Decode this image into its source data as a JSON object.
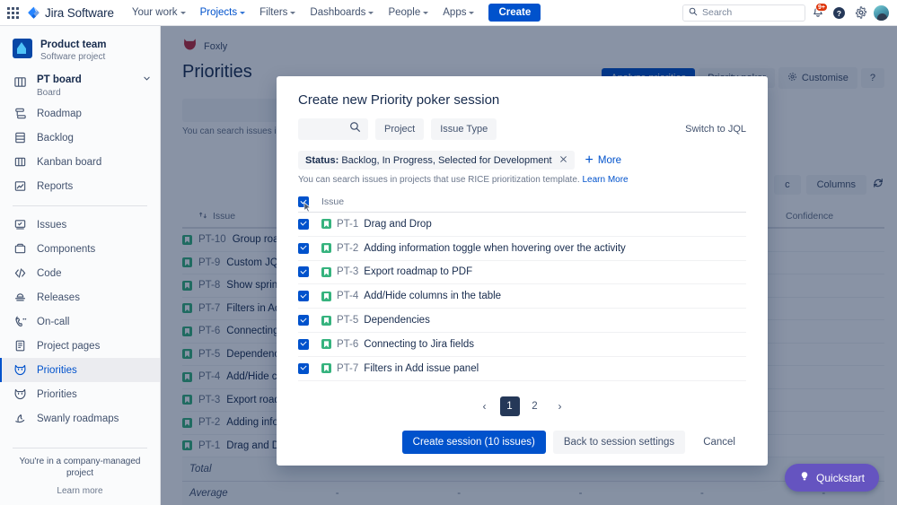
{
  "topnav": {
    "app_switcher_icon": "app-grid-icon",
    "brand": "Jira Software",
    "brand_logo_icon": "jira-logo-icon",
    "items": [
      {
        "label": "Your work",
        "active": false
      },
      {
        "label": "Projects",
        "active": true
      },
      {
        "label": "Filters",
        "active": false
      },
      {
        "label": "Dashboards",
        "active": false
      },
      {
        "label": "People",
        "active": false
      },
      {
        "label": "Apps",
        "active": false
      }
    ],
    "create_label": "Create",
    "search_placeholder": "Search",
    "search_icon": "search-icon",
    "notifications_icon": "bell-icon",
    "notifications_badge": "9+",
    "help_icon": "help-circle-icon",
    "settings_icon": "gear-icon",
    "avatar_icon": "avatar"
  },
  "sidebar": {
    "project_name": "Product team",
    "project_type": "Software project",
    "board": {
      "label": "PT board",
      "sub": "Board",
      "icon": "board-icon",
      "chevron": "chevron-down-icon"
    },
    "group1": [
      {
        "label": "Roadmap",
        "icon": "roadmap-icon"
      },
      {
        "label": "Backlog",
        "icon": "backlog-icon"
      },
      {
        "label": "Kanban board",
        "icon": "kanban-board-icon"
      },
      {
        "label": "Reports",
        "icon": "reports-icon"
      }
    ],
    "group2": [
      {
        "label": "Issues",
        "icon": "issues-icon",
        "selected": false
      },
      {
        "label": "Components",
        "icon": "components-icon",
        "selected": false
      },
      {
        "label": "Code",
        "icon": "code-icon",
        "selected": false
      },
      {
        "label": "Releases",
        "icon": "releases-icon",
        "selected": false
      },
      {
        "label": "On-call",
        "icon": "on-call-icon",
        "selected": false
      },
      {
        "label": "Project pages",
        "icon": "project-pages-icon",
        "selected": false
      },
      {
        "label": "Priorities",
        "icon": "foxly-icon",
        "selected": true
      },
      {
        "label": "Priorities",
        "icon": "foxly-icon",
        "selected": false
      },
      {
        "label": "Swanly roadmaps",
        "icon": "swanly-icon",
        "selected": false
      }
    ],
    "footer_note": "You're in a company-managed project",
    "footer_link": "Learn more"
  },
  "main": {
    "app_badge": "Foxly",
    "app_badge_icon": "foxly-logo-icon",
    "page_title": "Priorities",
    "actions": [
      {
        "label": "Analyze priorities",
        "style": "primary"
      },
      {
        "label": "Priority poker",
        "style": "subtle"
      },
      {
        "label": "Customise",
        "style": "subtle",
        "icon": "gear-icon"
      },
      {
        "label": "?",
        "style": "subtle"
      }
    ],
    "search_icon": "search-icon",
    "hint": "You can search issues in pr",
    "tools": [
      {
        "label": "c"
      },
      {
        "label": "Columns"
      }
    ],
    "refresh_icon": "refresh-icon",
    "table": {
      "columns": [
        "Issue",
        "Confidence"
      ],
      "sort_icon": "sort-icon",
      "rows": [
        {
          "key": "PT-10",
          "summary": "Group road"
        },
        {
          "key": "PT-9",
          "summary": "Custom JQL"
        },
        {
          "key": "PT-8",
          "summary": "Show sprints"
        },
        {
          "key": "PT-7",
          "summary": "Filters in Add"
        },
        {
          "key": "PT-6",
          "summary": "Connecting "
        },
        {
          "key": "PT-5",
          "summary": "Dependencie"
        },
        {
          "key": "PT-4",
          "summary": "Add/Hide co"
        },
        {
          "key": "PT-3",
          "summary": "Export roadm"
        },
        {
          "key": "PT-2",
          "summary": "Adding infor"
        },
        {
          "key": "PT-1",
          "summary": "Drag and Dro"
        }
      ],
      "total_label": "Total",
      "average_label": "Average",
      "empty_cell": "-"
    },
    "quickstart": {
      "label": "Quickstart",
      "icon": "lightbulb-icon"
    }
  },
  "modal": {
    "title": "Create new Priority poker session",
    "search_icon": "search-icon",
    "search_value": "",
    "filter_buttons": [
      "Project",
      "Issue Type"
    ],
    "switch_to_jql": "Switch to JQL",
    "chip": {
      "field": "Status:",
      "values": "Backlog, In Progress, Selected for Development",
      "remove_icon": "close-icon"
    },
    "more_label": "More",
    "more_icon": "plus-icon",
    "hint_text": "You can search issues in projects that use RICE prioritization template.",
    "hint_link": "Learn More",
    "list_header": "Issue",
    "header_checkbox_checked": true,
    "cursor_icon": "mouse-cursor-icon",
    "issues": [
      {
        "checked": true,
        "icon": "story-icon",
        "key": "PT-1",
        "summary": "Drag and Drop"
      },
      {
        "checked": true,
        "icon": "story-icon",
        "key": "PT-2",
        "summary": "Adding information toggle when hovering over the activity"
      },
      {
        "checked": true,
        "icon": "story-icon",
        "key": "PT-3",
        "summary": "Export roadmap to PDF"
      },
      {
        "checked": true,
        "icon": "story-icon",
        "key": "PT-4",
        "summary": "Add/Hide columns in the table"
      },
      {
        "checked": true,
        "icon": "story-icon",
        "key": "PT-5",
        "summary": "Dependencies"
      },
      {
        "checked": true,
        "icon": "story-icon",
        "key": "PT-6",
        "summary": "Connecting to Jira fields"
      },
      {
        "checked": true,
        "icon": "story-icon",
        "key": "PT-7",
        "summary": "Filters in Add issue panel"
      }
    ],
    "pagination": {
      "prev_icon": "chevron-left-icon",
      "next_icon": "chevron-right-icon",
      "pages": [
        "1",
        "2"
      ],
      "current": "1"
    },
    "buttons": {
      "create": "Create session (10 issues)",
      "back": "Back to session settings",
      "cancel": "Cancel"
    }
  },
  "colors": {
    "brand_blue": "#0052cc",
    "story_green": "#36b37e",
    "badge_red": "#de350b",
    "quickstart_purple": "#6554c0",
    "pager_active": "#253858",
    "foxly_red": "#bf2a3a"
  }
}
